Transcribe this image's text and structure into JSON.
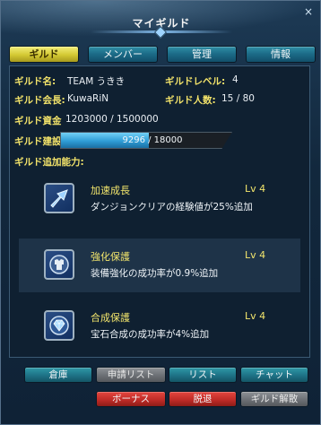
{
  "window": {
    "title": "マイギルド",
    "close_glyph": "×"
  },
  "tabs": [
    {
      "label": "ギルド",
      "active": true
    },
    {
      "label": "メンバー",
      "active": false
    },
    {
      "label": "管理",
      "active": false
    },
    {
      "label": "情報",
      "active": false
    }
  ],
  "info": {
    "guild_name_label": "ギルド名:",
    "guild_name": "TEAM うきき",
    "guild_level_label": "ギルドレベル:",
    "guild_level": "4",
    "guild_master_label": "ギルド会長:",
    "guild_master": "KuwaRiN",
    "guild_members_label": "ギルド人数:",
    "guild_members": "15 / 80",
    "guild_funds_label": "ギルド資金",
    "guild_funds": "1203000 / 1500000",
    "guild_build_label": "ギルド建設:",
    "guild_build_text": "9296 / 18000",
    "guild_build_progress": 0.5164,
    "abilities_label": "ギルド追加能力:"
  },
  "abilities": [
    {
      "name": "加速成長",
      "level": "Lv 4",
      "desc": "ダンジョンクリアの経験値が25%追加",
      "icon": "arrow-up-icon",
      "shaded": false
    },
    {
      "name": "強化保護",
      "level": "Lv 4",
      "desc": "装備強化の成功率が0.9%追加",
      "icon": "armor-icon",
      "shaded": true
    },
    {
      "name": "合成保護",
      "level": "Lv 4",
      "desc": "宝石合成の成功率が4%追加",
      "icon": "gem-icon",
      "shaded": false
    }
  ],
  "buttons": {
    "warehouse": "倉庫",
    "apply_list": "申請リスト",
    "list": "リスト",
    "chat": "チャット",
    "bonus": "ボーナス",
    "leave": "脱退",
    "disband": "ギルド解散"
  },
  "colors": {
    "label_yellow": "#f3e36a",
    "tab_active": "#d3c832",
    "button_teal": "#1e7286",
    "button_red": "#c12c27",
    "progress_blue": "#2f9dd6"
  }
}
